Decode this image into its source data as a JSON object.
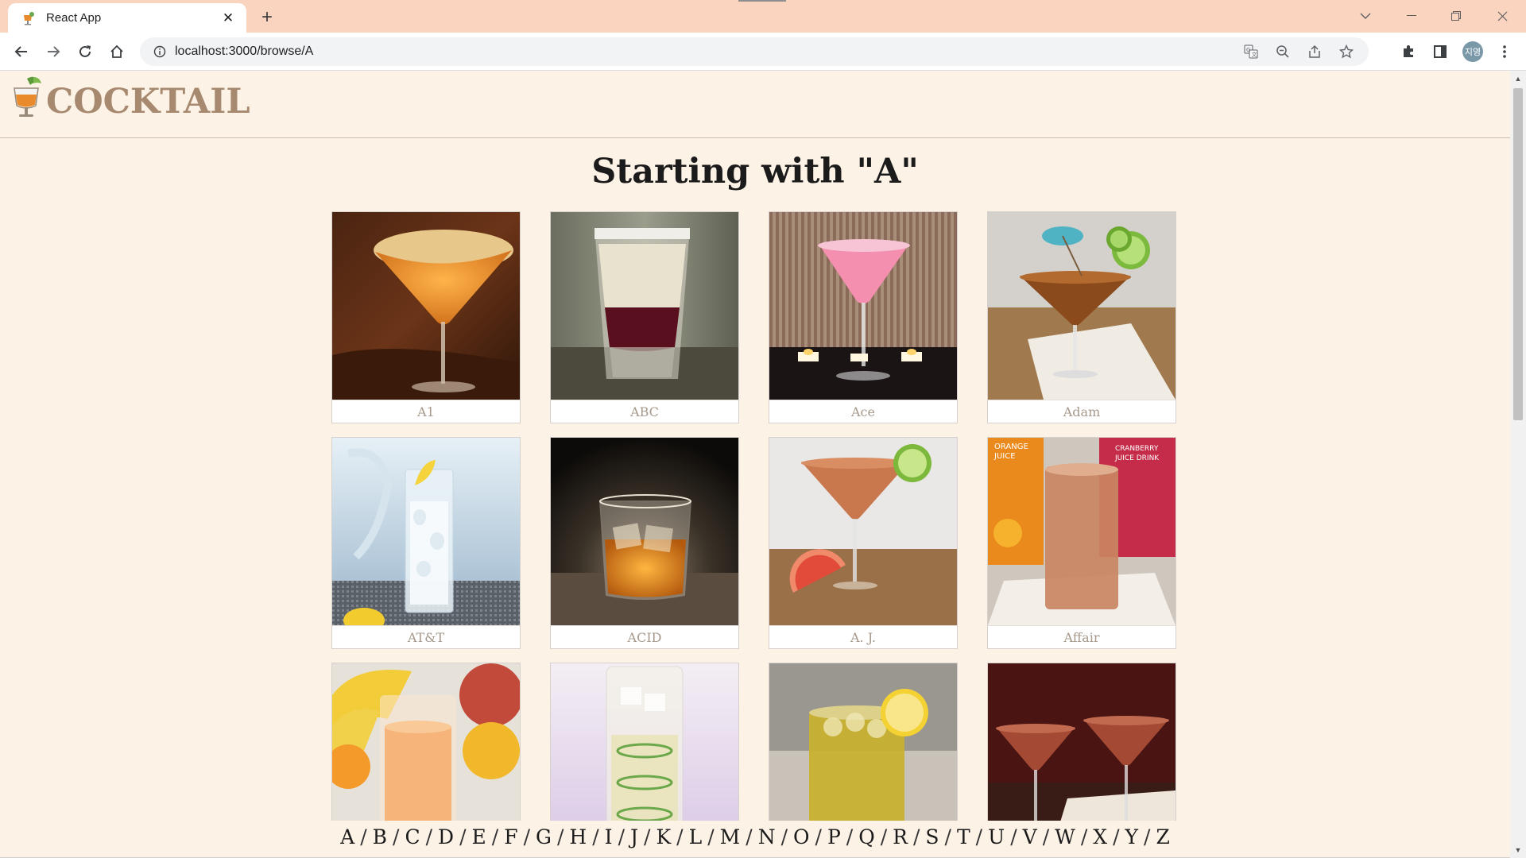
{
  "browser": {
    "tab_title": "React App",
    "url": "localhost:3000/browse/A",
    "profile_initials": "지영"
  },
  "site": {
    "logo_text": "COCKTAIL",
    "heading": "Starting with \"A\""
  },
  "drinks": [
    {
      "name": "A1",
      "image": "amber martini with sugared rim"
    },
    {
      "name": "ABC",
      "image": "layered shot glass"
    },
    {
      "name": "Ace",
      "image": "pink martini with candles"
    },
    {
      "name": "Adam",
      "image": "martini with lime and umbrella"
    },
    {
      "name": "AT&T",
      "image": "highball with lemon"
    },
    {
      "name": "ACID",
      "image": "whiskey on the rocks"
    },
    {
      "name": "A. J.",
      "image": "martini with grapefruit and lime"
    },
    {
      "name": "Affair",
      "image": "tall glass with juice cartons"
    },
    {
      "name": "",
      "image": "orange juice glass with bananas"
    },
    {
      "name": "",
      "image": "highball with cucumber slices"
    },
    {
      "name": "",
      "image": "yellow drink with lemon"
    },
    {
      "name": "",
      "image": "two red martinis"
    }
  ],
  "alphabet": [
    "A",
    "B",
    "C",
    "D",
    "E",
    "F",
    "G",
    "H",
    "I",
    "J",
    "K",
    "L",
    "M",
    "N",
    "O",
    "P",
    "Q",
    "R",
    "S",
    "T",
    "U",
    "V",
    "W",
    "X",
    "Y",
    "Z"
  ],
  "colors": {
    "background": "#fdf2e6",
    "logo": "#a6896f",
    "tabstrip": "#fbd4c0"
  }
}
